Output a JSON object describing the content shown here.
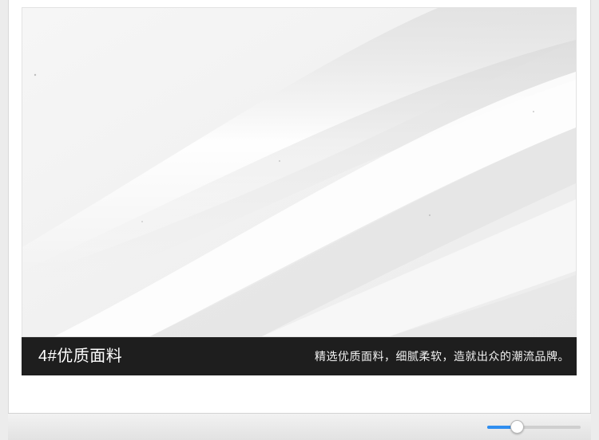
{
  "product_detail": {
    "image_description_alt": "",
    "caption_title": "4#优质面料",
    "caption_text": "精选优质面料，细腻柔软，造就出众的潮流品牌。"
  },
  "zoom_slider": {
    "value_fraction": 0.32,
    "accent_color": "#2f8ef0"
  }
}
